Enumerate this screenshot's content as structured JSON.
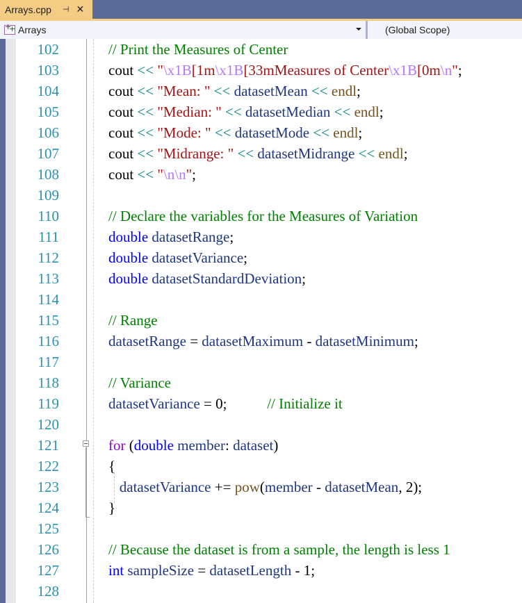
{
  "tab": {
    "title": "Arrays.cpp",
    "pin_icon": "pin-icon",
    "close_icon": "close-icon"
  },
  "navbar": {
    "project": "Arrays",
    "scope": "(Global Scope)"
  },
  "colors": {
    "tab_active": "#f5cc84",
    "line_number": "#2b91af",
    "comment": "#008000",
    "keyword": "#0000ff",
    "string": "#a31515",
    "escape": "#b776fb"
  },
  "line_numbers": [
    "102",
    "103",
    "104",
    "105",
    "106",
    "107",
    "108",
    "109",
    "110",
    "111",
    "112",
    "113",
    "114",
    "115",
    "116",
    "117",
    "118",
    "119",
    "120",
    "121",
    "122",
    "123",
    "124",
    "125",
    "126",
    "127",
    "128"
  ],
  "code": {
    "l102": {
      "comment": "// Print the Measures of Center"
    },
    "l103": {
      "a": "cout",
      "op": " << ",
      "q1": "\"",
      "e1": "\\x1B",
      "s1": "[1m",
      "e2": "\\x1B",
      "s2": "[33mMeasures of Center",
      "e3": "\\x1B",
      "s3": "[0m",
      "e4": "\\n",
      "q2": "\"",
      "end": ";"
    },
    "l104": {
      "a": "cout",
      "op1": " << ",
      "s": "\"Mean: \"",
      "op2": " << ",
      "id": "datasetMean",
      "op3": " << ",
      "fn": "endl",
      "end": ";"
    },
    "l105": {
      "a": "cout",
      "op1": " << ",
      "s": "\"Median: \"",
      "op2": " << ",
      "id": "datasetMedian",
      "op3": " << ",
      "fn": "endl",
      "end": ";"
    },
    "l106": {
      "a": "cout",
      "op1": " << ",
      "s": "\"Mode: \"",
      "op2": " << ",
      "id": "datasetMode",
      "op3": " << ",
      "fn": "endl",
      "end": ";"
    },
    "l107": {
      "a": "cout",
      "op1": " << ",
      "s": "\"Midrange: \"",
      "op2": " << ",
      "id": "datasetMidrange",
      "op3": " << ",
      "fn": "endl",
      "end": ";"
    },
    "l108": {
      "a": "cout",
      "op": " << ",
      "q1": "\"",
      "e": "\\n\\n",
      "q2": "\"",
      "end": ";"
    },
    "l110": {
      "comment": "// Declare the variables for the Measures of Variation"
    },
    "l111": {
      "kw": "double",
      "id": " datasetRange",
      "end": ";"
    },
    "l112": {
      "kw": "double",
      "id": " datasetVariance",
      "end": ";"
    },
    "l113": {
      "kw": "double",
      "id": " datasetStandardDeviation",
      "end": ";"
    },
    "l115": {
      "comment": "// Range"
    },
    "l116": {
      "id1": "datasetRange",
      "eq": " = ",
      "id2": "datasetMaximum",
      "minus": " - ",
      "id3": "datasetMinimum",
      "end": ";"
    },
    "l118": {
      "comment": "// Variance"
    },
    "l119": {
      "id": "datasetVariance",
      "rest": " = 0;",
      "pad": "           ",
      "comment": "// Initialize it"
    },
    "l121": {
      "kw": "for",
      "p1": " (",
      "kw2": "double",
      "id": " member",
      "colon": ": ",
      "id2": "dataset",
      "p2": ")"
    },
    "l122": {
      "brace": "{"
    },
    "l123": {
      "indent": "   ",
      "id": "datasetVariance",
      "op": " += ",
      "fn": "pow",
      "p1": "(",
      "id2": "member",
      "minus": " - ",
      "id3": "datasetMean",
      "rest": ", 2);"
    },
    "l124": {
      "brace": "}"
    },
    "l126": {
      "comment": "// Because the dataset is from a sample, the length is less 1"
    },
    "l127": {
      "kw": "int",
      "id": " sampleSize",
      "eq": " = ",
      "id2": "datasetLength",
      "rest": " - 1;"
    }
  }
}
